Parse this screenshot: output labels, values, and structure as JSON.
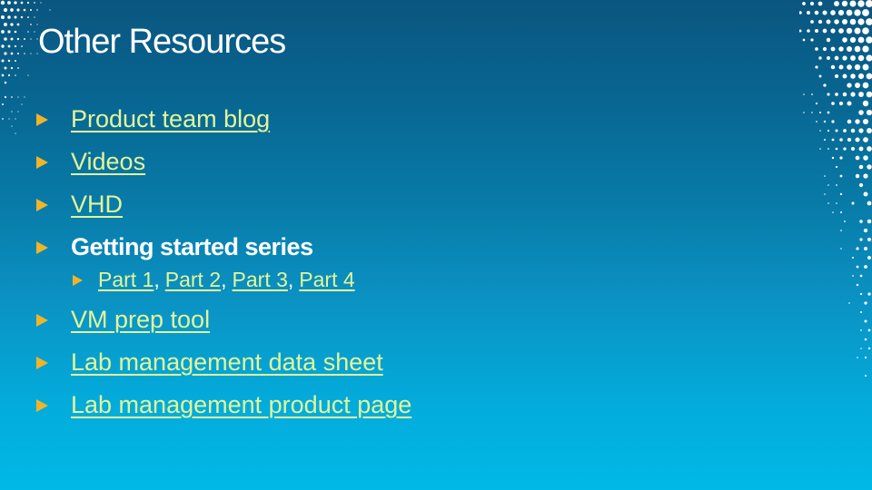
{
  "slide": {
    "title": "Other Resources",
    "colors": {
      "background_top": "#0a5680",
      "background_bottom": "#00b9e6",
      "title": "#ffffff",
      "link": "#e2f59a",
      "bullet": "#f1b427",
      "heading": "#ffffff"
    },
    "items": [
      {
        "type": "link",
        "label": "Product team blog"
      },
      {
        "type": "link",
        "label": "Videos"
      },
      {
        "type": "link",
        "label": "VHD"
      },
      {
        "type": "heading",
        "label": "Getting started series",
        "sub_items": [
          {
            "label": "Part 1"
          },
          {
            "label": "Part 2"
          },
          {
            "label": "Part 3"
          },
          {
            "label": "Part 4"
          }
        ],
        "separator": ","
      },
      {
        "type": "link",
        "label": "VM prep tool"
      },
      {
        "type": "link",
        "label": "Lab management data sheet"
      },
      {
        "type": "link",
        "label": "Lab management product page"
      }
    ],
    "bullet_icon": "triangle-right-icon",
    "decoration_icon": "halftone-dots-pattern"
  }
}
